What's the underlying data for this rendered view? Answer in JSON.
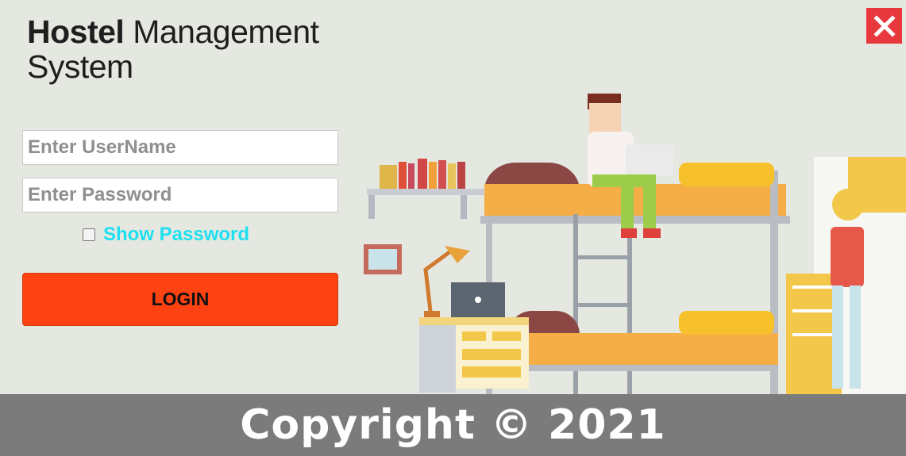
{
  "app": {
    "title_bold": "Hostel",
    "title_rest": " Management",
    "title_line2": "System",
    "accent_color": "#ff4212",
    "close_color": "#e8383d"
  },
  "login_form": {
    "username_placeholder": "Enter UserName",
    "username_value": "",
    "password_placeholder": "Enter Password",
    "password_value": "",
    "show_password_label": "Show Password",
    "show_password_checked": false,
    "login_label": "LOGIN"
  },
  "icons": {
    "close": "close-icon",
    "checkbox": "checkbox-icon",
    "illustration": "hostel-room-illustration"
  },
  "footer": {
    "copyright": "Copyright © 2021"
  }
}
